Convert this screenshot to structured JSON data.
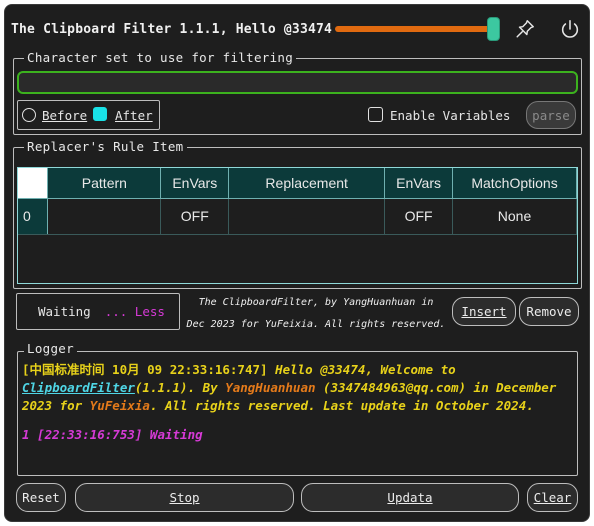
{
  "window": {
    "title": "The Clipboard Filter 1.1.1, Hello @33474",
    "opacity_slider_fraction": 0.95
  },
  "charset_group": {
    "label": "Character set to use for filtering",
    "input_value": ""
  },
  "position_options": {
    "before_label": "Before",
    "after_label": "After",
    "selected": "After"
  },
  "variables": {
    "enable_label": "Enable Variables",
    "checked": false,
    "parse_label": "parse"
  },
  "rules_group": {
    "label": "Replacer's Rule Item",
    "columns": [
      "Pattern",
      "EnVars",
      "Replacement",
      "EnVars",
      "MatchOptions"
    ],
    "rows": [
      {
        "index": "0",
        "pattern": "",
        "envars1": "OFF",
        "replacement": "",
        "envars2": "OFF",
        "match_options": "None"
      }
    ]
  },
  "status": {
    "text": "Waiting",
    "toggle": "... Less"
  },
  "credit": {
    "line1": "The ClipboardFilter, by YangHuanhuan in",
    "line2": "Dec 2023 for YuFeixia. All rights reserved."
  },
  "actions": {
    "insert_label": "Insert",
    "remove_label": "Remove"
  },
  "logger": {
    "label": "Logger",
    "entry1": {
      "timestamp": "[中国标准时间 10月 09 22:33:16:747]",
      "t1": " Hello @33474, Welcome to",
      "link": "ClipboardFilter",
      "t2": "(1.1.1). By ",
      "author": "YangHuanhuan",
      "t3": " (3347484963@qq.com) in December 2023 for ",
      "recipient": "YuFeixia",
      "t4": ". All rights reserved. Last update in October 2024."
    },
    "entry2": {
      "text": "1 [22:33:16:753] Waiting"
    }
  },
  "bottom_buttons": {
    "reset_label": "Reset",
    "stop_label": "Stop",
    "updata_label": "Updata",
    "clear_label": "Clear"
  },
  "colors": {
    "accent_green": "#3cb21e",
    "accent_cyan": "#19e1e6",
    "slider_orange": "#e06a10",
    "log_yellow": "#e8d21a",
    "log_orange": "#e47a1a",
    "log_magenta": "#d63ad6"
  },
  "icons": [
    "pin-icon",
    "power-icon"
  ]
}
